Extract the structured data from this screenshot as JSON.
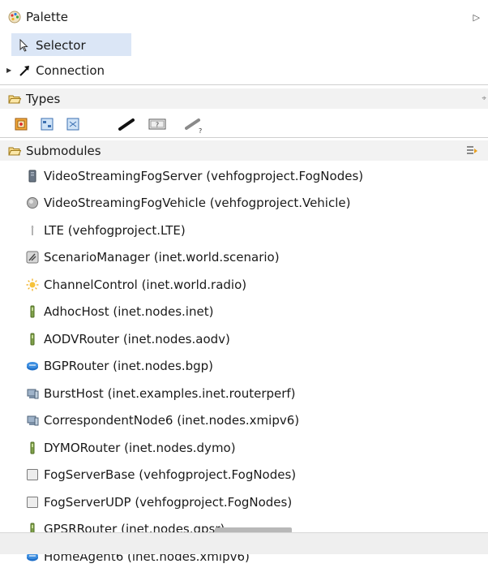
{
  "palette": {
    "title": "Palette",
    "collapse_glyph": "▷"
  },
  "tools": {
    "selector": "Selector",
    "connection": "Connection"
  },
  "types": {
    "title": "Types",
    "icons": [
      "compound-module-icon",
      "simple-module-icon",
      "network-icon",
      "channel-icon",
      "interface-icon",
      "unknown-channel-icon"
    ]
  },
  "submodules": {
    "title": "Submodules",
    "items": [
      "VideoStreamingFogServer (vehfogproject.FogNodes)",
      "VideoStreamingFogVehicle (vehfogproject.Vehicle)",
      "LTE (vehfogproject.LTE)",
      "ScenarioManager (inet.world.scenario)",
      "ChannelControl (inet.world.radio)",
      "AdhocHost (inet.nodes.inet)",
      "AODVRouter (inet.nodes.aodv)",
      "BGPRouter (inet.nodes.bgp)",
      "BurstHost (inet.examples.inet.routerperf)",
      "CorrespondentNode6 (inet.nodes.xmipv6)",
      "DYMORouter (inet.nodes.dymo)",
      "FogServerBase (vehfogproject.FogNodes)",
      "FogServerUDP (vehfogproject.FogNodes)",
      "GPSRRouter (inet.nodes.gpsr)",
      "HomeAgent6 (inet.nodes.xmipv6)"
    ],
    "item_icons": [
      "server-icon",
      "vehicle-icon",
      "antenna-icon",
      "scenario-icon",
      "sun-icon",
      "wireless-host-icon",
      "wireless-host-icon",
      "router-icon",
      "host-icon",
      "host-icon",
      "wireless-host-icon",
      "module-box-icon",
      "module-box-icon",
      "wireless-host-icon",
      "router-icon"
    ]
  }
}
